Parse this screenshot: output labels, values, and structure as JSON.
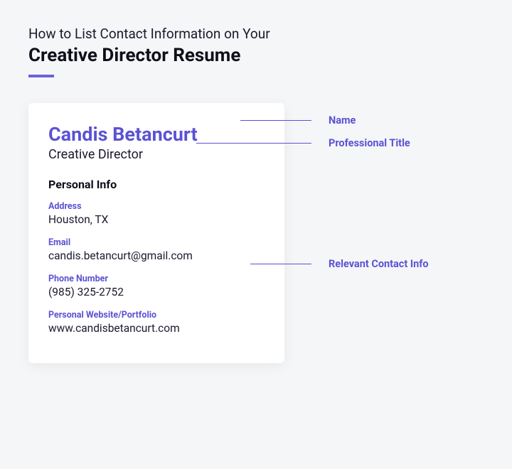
{
  "header": {
    "kicker": "How to List Contact Information on Your",
    "title": "Creative Director Resume"
  },
  "card": {
    "name": "Candis Betancurt",
    "title": "Creative Director",
    "section_heading": "Personal Info",
    "fields": {
      "address": {
        "label": "Address",
        "value": "Houston, TX"
      },
      "email": {
        "label": "Email",
        "value": "candis.betancurt@gmail.com"
      },
      "phone": {
        "label": "Phone Number",
        "value": "(985) 325-2752"
      },
      "website": {
        "label": "Personal Website/Portfolio",
        "value": "www.candisbetancurt.com"
      }
    }
  },
  "annotations": {
    "name": "Name",
    "title": "Professional Title",
    "contact": "Relevant Contact Info"
  }
}
